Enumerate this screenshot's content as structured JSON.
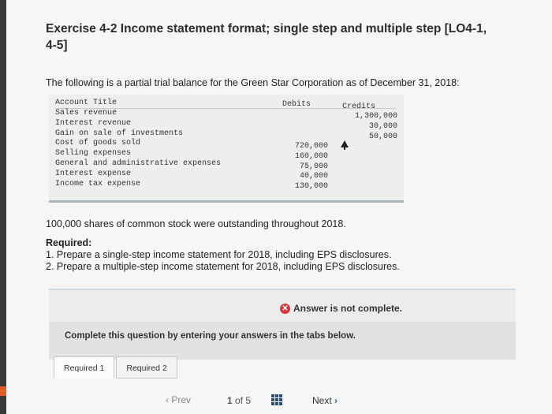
{
  "exercise": {
    "title_line1": "Exercise 4-2 Income statement format; single step and multiple step [LO4-1,",
    "title_line2": "4-5]",
    "intro": "The following is a partial trial balance for the Green Star Corporation as of December 31, 2018:"
  },
  "trial_balance": {
    "headers": {
      "account": "Account Title",
      "debits": "Debits",
      "credits": "Credits"
    },
    "rows": [
      {
        "account": "Sales revenue",
        "debit": "",
        "credit": "1,300,000"
      },
      {
        "account": "Interest revenue",
        "debit": "",
        "credit": "30,000"
      },
      {
        "account": "Gain on sale of investments",
        "debit": "",
        "credit": "50,000"
      },
      {
        "account": "Cost of goods sold",
        "debit": "720,000",
        "credit": ""
      },
      {
        "account": "Selling expenses",
        "debit": "160,000",
        "credit": ""
      },
      {
        "account": "General and administrative expenses",
        "debit": "75,000",
        "credit": ""
      },
      {
        "account": "Interest expense",
        "debit": "40,000",
        "credit": ""
      },
      {
        "account": "Income tax expense",
        "debit": "130,000",
        "credit": ""
      }
    ]
  },
  "shares_note": "100,000 shares of common stock were outstanding throughout 2018.",
  "requirements": {
    "label": "Required:",
    "item1": "1. Prepare a single-step income statement for 2018, including EPS disclosures.",
    "item2": "2. Prepare a multiple-step income statement for 2018, including EPS disclosures."
  },
  "status": {
    "text": "Answer is not complete.",
    "color": "#d9363e"
  },
  "instruction": "Complete this question by entering your answers in the tabs below.",
  "tabs": [
    {
      "label": "Required 1"
    },
    {
      "label": "Required 2"
    }
  ],
  "navigation": {
    "prev": "Prev",
    "page_current": "1",
    "page_of": "of",
    "page_total": "5",
    "next": "Next"
  }
}
